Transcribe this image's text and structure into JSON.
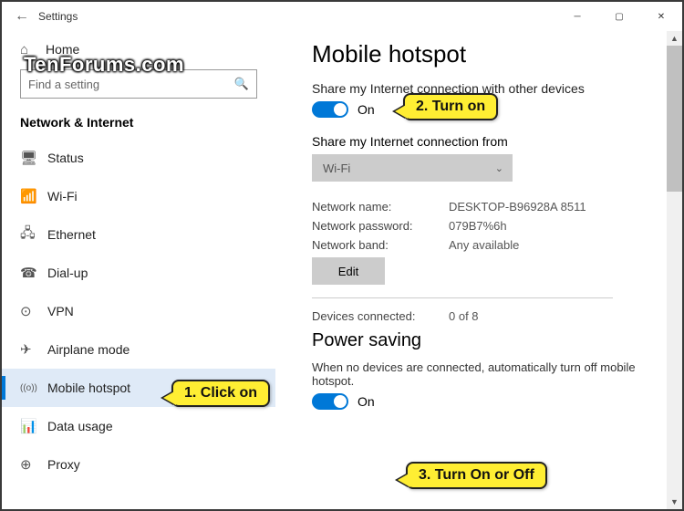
{
  "titlebar": {
    "title": "Settings",
    "back": "←"
  },
  "watermark": "TenForums.com",
  "sidebar": {
    "home_label": "Home",
    "search_placeholder": "Find a setting",
    "category": "Network & Internet",
    "items": [
      {
        "icon": "🖥",
        "label": "Status"
      },
      {
        "icon": "📶",
        "label": "Wi-Fi"
      },
      {
        "icon": "🖧",
        "label": "Ethernet"
      },
      {
        "icon": "☎",
        "label": "Dial-up"
      },
      {
        "icon": "⊙",
        "label": "VPN"
      },
      {
        "icon": "✈",
        "label": "Airplane mode"
      },
      {
        "icon": "((o))",
        "label": "Mobile hotspot"
      },
      {
        "icon": "📊",
        "label": "Data usage"
      },
      {
        "icon": "⊕",
        "label": "Proxy"
      }
    ]
  },
  "main": {
    "heading": "Mobile hotspot",
    "share_label": "Share my Internet connection with other devices",
    "share_toggle_state": "On",
    "from_label": "Share my Internet connection from",
    "from_value": "Wi-Fi",
    "network_name_label": "Network name:",
    "network_name_value": "DESKTOP-B96928A 8511",
    "network_password_label": "Network password:",
    "network_password_value": "079B7%6h",
    "network_band_label": "Network band:",
    "network_band_value": "Any available",
    "edit_button": "Edit",
    "devices_connected_label": "Devices connected:",
    "devices_connected_value": "0 of 8",
    "power_heading": "Power saving",
    "power_text": "When no devices are connected, automatically turn off mobile hotspot.",
    "power_toggle_state": "On"
  },
  "callouts": {
    "c1": "1. Click on",
    "c2": "2. Turn on",
    "c3": "3. Turn On or Off"
  }
}
